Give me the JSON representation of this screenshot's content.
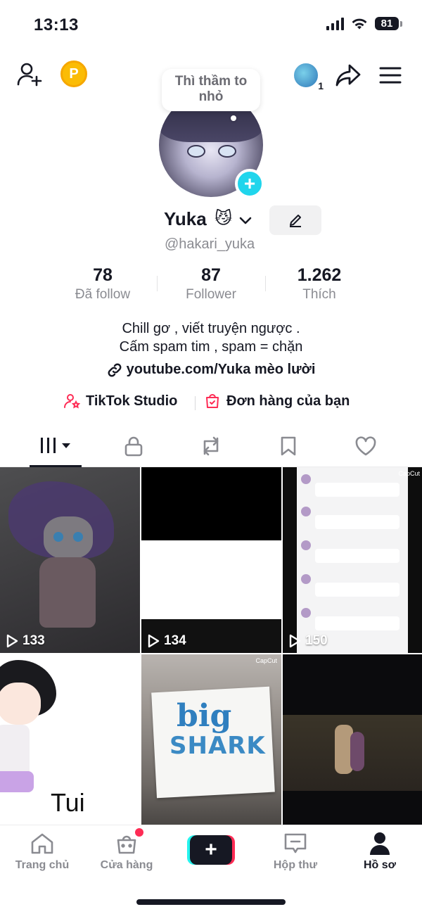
{
  "status_bar": {
    "time": "13:13",
    "battery": "81"
  },
  "top_nav": {
    "coin_label": "P",
    "mini_avatar_count": "1"
  },
  "profile": {
    "note": "Thì thầm to nhỏ",
    "add_story": "+",
    "display_name": "Yuka",
    "name_emoji": "😼",
    "username": "@hakari_yuka",
    "stats": [
      {
        "value": "78",
        "label": "Đã follow"
      },
      {
        "value": "87",
        "label": "Follower"
      },
      {
        "value": "1.262",
        "label": "Thích"
      }
    ],
    "bio_line1": "Chill gơ , viết truyện ngược .",
    "bio_line2": "Cấm spam tim , spam = chặn",
    "link": "youtube.com/Yuka mèo lười",
    "quick_links": [
      {
        "label": "TikTok Studio",
        "icon": "person-star-icon"
      },
      {
        "label": "Đơn hàng của bạn",
        "icon": "shopping-bag-check-icon"
      }
    ]
  },
  "tabs": [
    {
      "name": "videos",
      "icon": "grid-icon",
      "active": true
    },
    {
      "name": "private",
      "icon": "lock-icon",
      "active": false
    },
    {
      "name": "reposts",
      "icon": "repost-icon",
      "active": false
    },
    {
      "name": "favorites",
      "icon": "bookmark-icon",
      "active": false
    },
    {
      "name": "liked",
      "icon": "heart-icon",
      "active": false
    }
  ],
  "videos": [
    {
      "views": "133"
    },
    {
      "views": "134"
    },
    {
      "views": "150"
    },
    {
      "views": "",
      "caption": "Tui"
    },
    {
      "views": "",
      "caption_line1": "big",
      "caption_line2": "SHARK",
      "watermark": "CapCut"
    },
    {
      "views": ""
    }
  ],
  "video3_watermark": "CapCut",
  "bottom_nav": {
    "home": "Trang chủ",
    "shop": "Cửa hàng",
    "create": "+",
    "inbox": "Hộp thư",
    "profile": "Hồ sơ"
  },
  "colors": {
    "accent_red": "#fe2c55",
    "accent_cyan": "#25f4ee",
    "story_blue": "#20d5ec",
    "coin_gold": "#fbbc05",
    "text_primary": "#161823",
    "text_secondary": "#8a8b91"
  }
}
